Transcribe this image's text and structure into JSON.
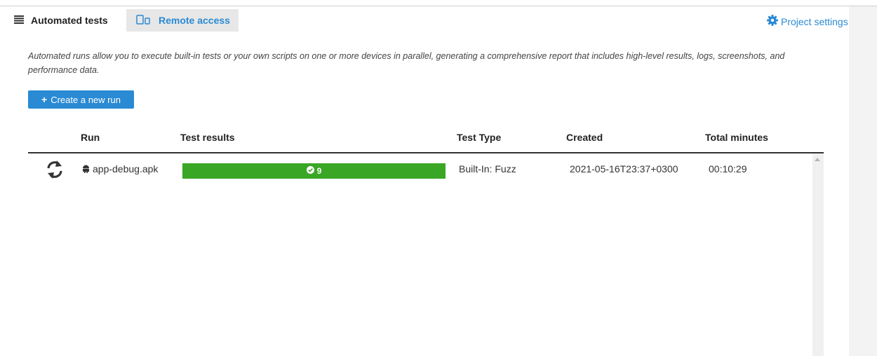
{
  "tabs": {
    "automated_label": "Automated tests",
    "remote_label": "Remote access"
  },
  "header": {
    "settings_label": "Project settings"
  },
  "main": {
    "description": "Automated runs allow you to execute built-in tests or your own scripts on one or more devices in parallel, generating a comprehensive report that includes high-level results, logs, screenshots, and performance data.",
    "create_label": "Create a new run"
  },
  "table": {
    "columns": [
      "Run",
      "Test results",
      "Test Type",
      "Created",
      "Total minutes"
    ],
    "rows": [
      {
        "status_icon": "refresh-icon",
        "run": "app-debug.apk",
        "run_icon": "android-icon",
        "passed": "9",
        "test_type": "Built-In: Fuzz",
        "created": "2021-05-16T23:37+0300",
        "total_minutes": "00:10:29"
      }
    ]
  },
  "colors": {
    "accent": "#2a8ad3",
    "success": "#3aa625"
  }
}
